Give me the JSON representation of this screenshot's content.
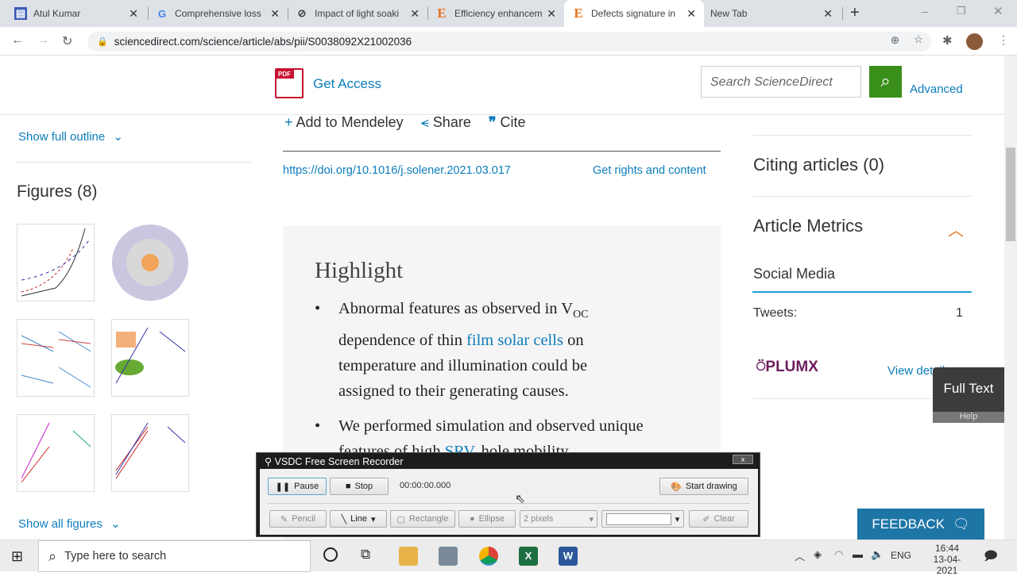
{
  "browser": {
    "tabs": [
      {
        "title": "Atul Kumar",
        "icon": "blogger-icon"
      },
      {
        "title": "Comprehensive loss",
        "icon": "google-icon"
      },
      {
        "title": "Impact of light soaki",
        "icon": "pdf-tab-icon"
      },
      {
        "title": "Efficiency enhancem",
        "icon": "elsevier-icon"
      },
      {
        "title": "Defects signature in",
        "icon": "elsevier-icon",
        "active": true
      },
      {
        "title": "New Tab",
        "icon": ""
      }
    ],
    "url": "sciencedirect.com/science/article/abs/pii/S0038092X21002036"
  },
  "header": {
    "get_access": "Get Access",
    "search_placeholder": "Search ScienceDirect",
    "advanced": "Advanced"
  },
  "actions": {
    "mendeley": "Add to Mendeley",
    "share": "Share",
    "cite": "Cite"
  },
  "doi": "https://doi.org/10.1016/j.solener.2021.03.017",
  "rights": "Get rights and content",
  "sidebar": {
    "outline": "Show full outline",
    "figures_title": "Figures (8)",
    "show_all": "Show all figures"
  },
  "highlight": {
    "title": "Highlight",
    "b1_pre": "Abnormal features as observed in V",
    "b1_sub": "OC",
    "b1_mid": " dependence of thin ",
    "b1_link": "film solar cells",
    "b1_post": " on temperature and illumination could be assigned to their generating causes.",
    "b2_pre": "We performed simulation and observed unique features of high ",
    "b2_link": "SRV",
    "b2_post": ", hole mobility"
  },
  "right": {
    "citing": "Citing articles (0)",
    "metrics": "Article Metrics",
    "social": "Social Media",
    "tweets_label": "Tweets:",
    "tweets_value": "1",
    "plumx": "PLUMX",
    "view_details": "View details",
    "fulltext": "Full Text",
    "help": "Help",
    "feedback": "FEEDBACK"
  },
  "recorder": {
    "title": "VSDC Free Screen Recorder",
    "pause": "Pause",
    "stop": "Stop",
    "time": "00:00:00.000",
    "start_drawing": "Start drawing",
    "pencil": "Pencil",
    "line": "Line",
    "rectangle": "Rectangle",
    "ellipse": "Ellipse",
    "width": "2 pixels",
    "clear": "Clear"
  },
  "taskbar": {
    "search_placeholder": "Type here to search",
    "lang": "ENG",
    "time": "16:44",
    "date": "13-04-2021"
  },
  "colors": {
    "accent": "#0c7dbb",
    "orange": "#e9711c",
    "search_green": "#3a8f1a",
    "feedback": "#1e76a6"
  }
}
